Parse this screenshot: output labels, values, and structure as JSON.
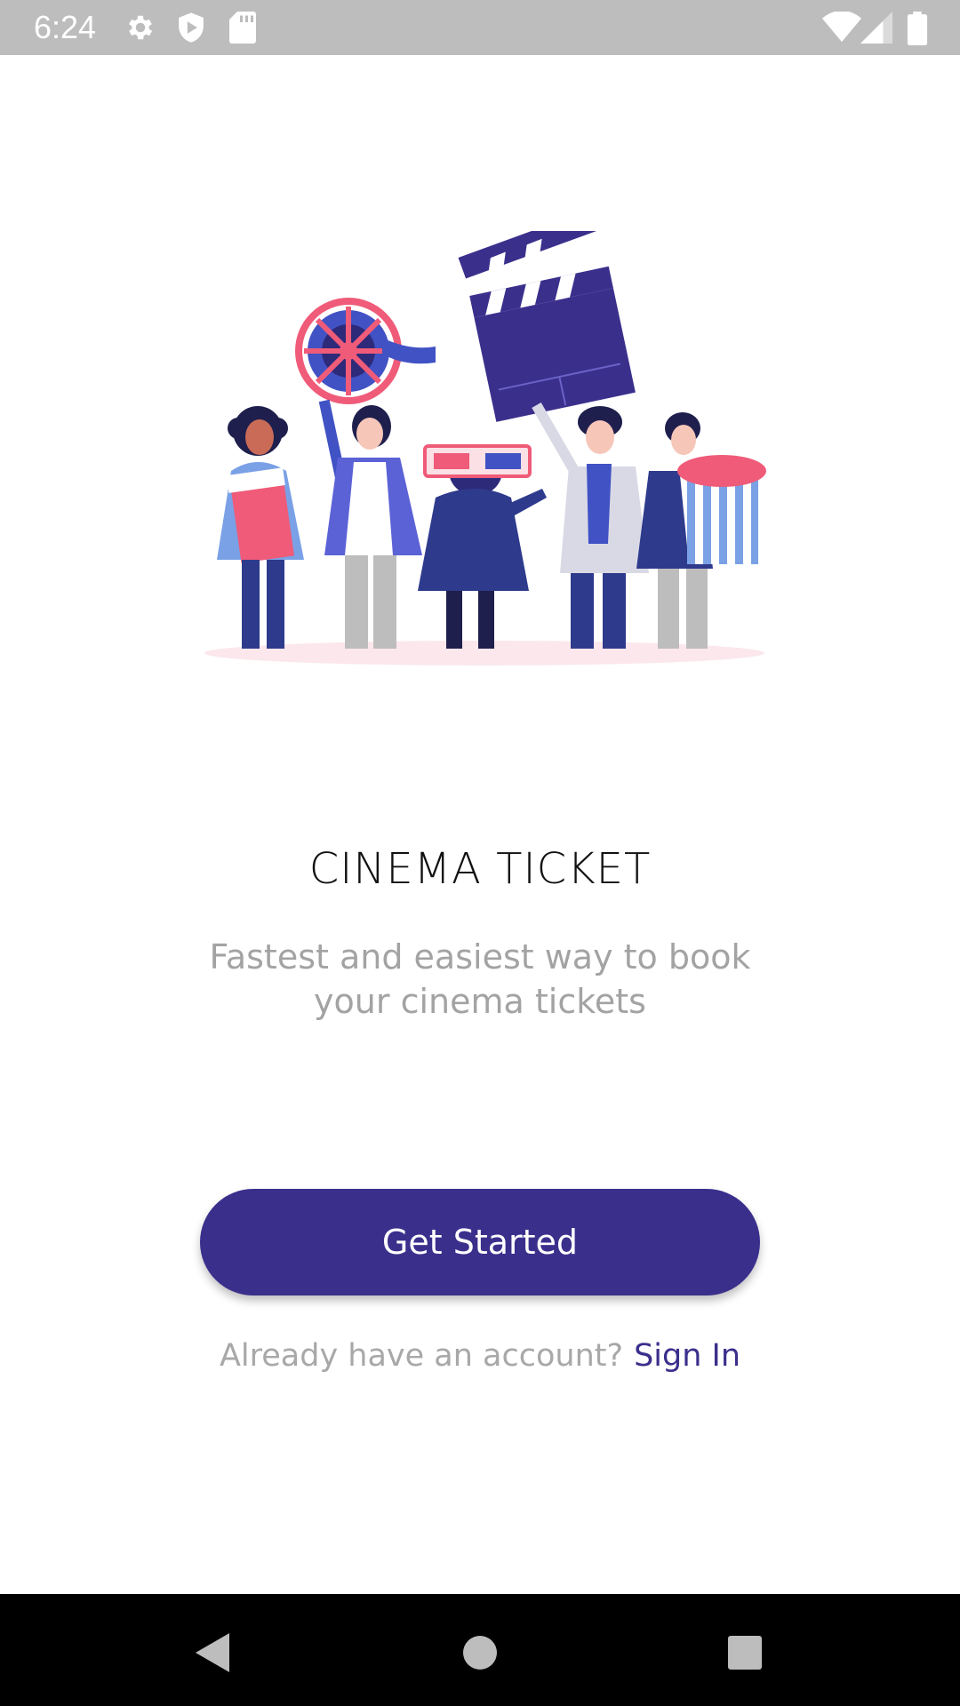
{
  "status_bar": {
    "time": "6:24",
    "icons": [
      "settings-icon",
      "shield-icon",
      "sd-card-icon",
      "wifi-icon",
      "signal-icon",
      "battery-icon"
    ]
  },
  "illustration": {
    "icon": "cinema-people-illustration"
  },
  "main": {
    "title": "CINEMA TICKET",
    "subtitle": "Fastest and easiest way to book your cinema tickets",
    "cta_label": "Get Started",
    "signin_prompt": "Already have an account?",
    "signin_link": "Sign In"
  },
  "nav_bar": {
    "buttons": [
      "back-icon",
      "home-icon",
      "recents-icon"
    ]
  },
  "colors": {
    "accent": "#3b2f8c",
    "status_bar": "#bdbdbd",
    "muted_text": "#a3a3a3",
    "pink": "#ef5b78",
    "blue": "#4052c4"
  }
}
